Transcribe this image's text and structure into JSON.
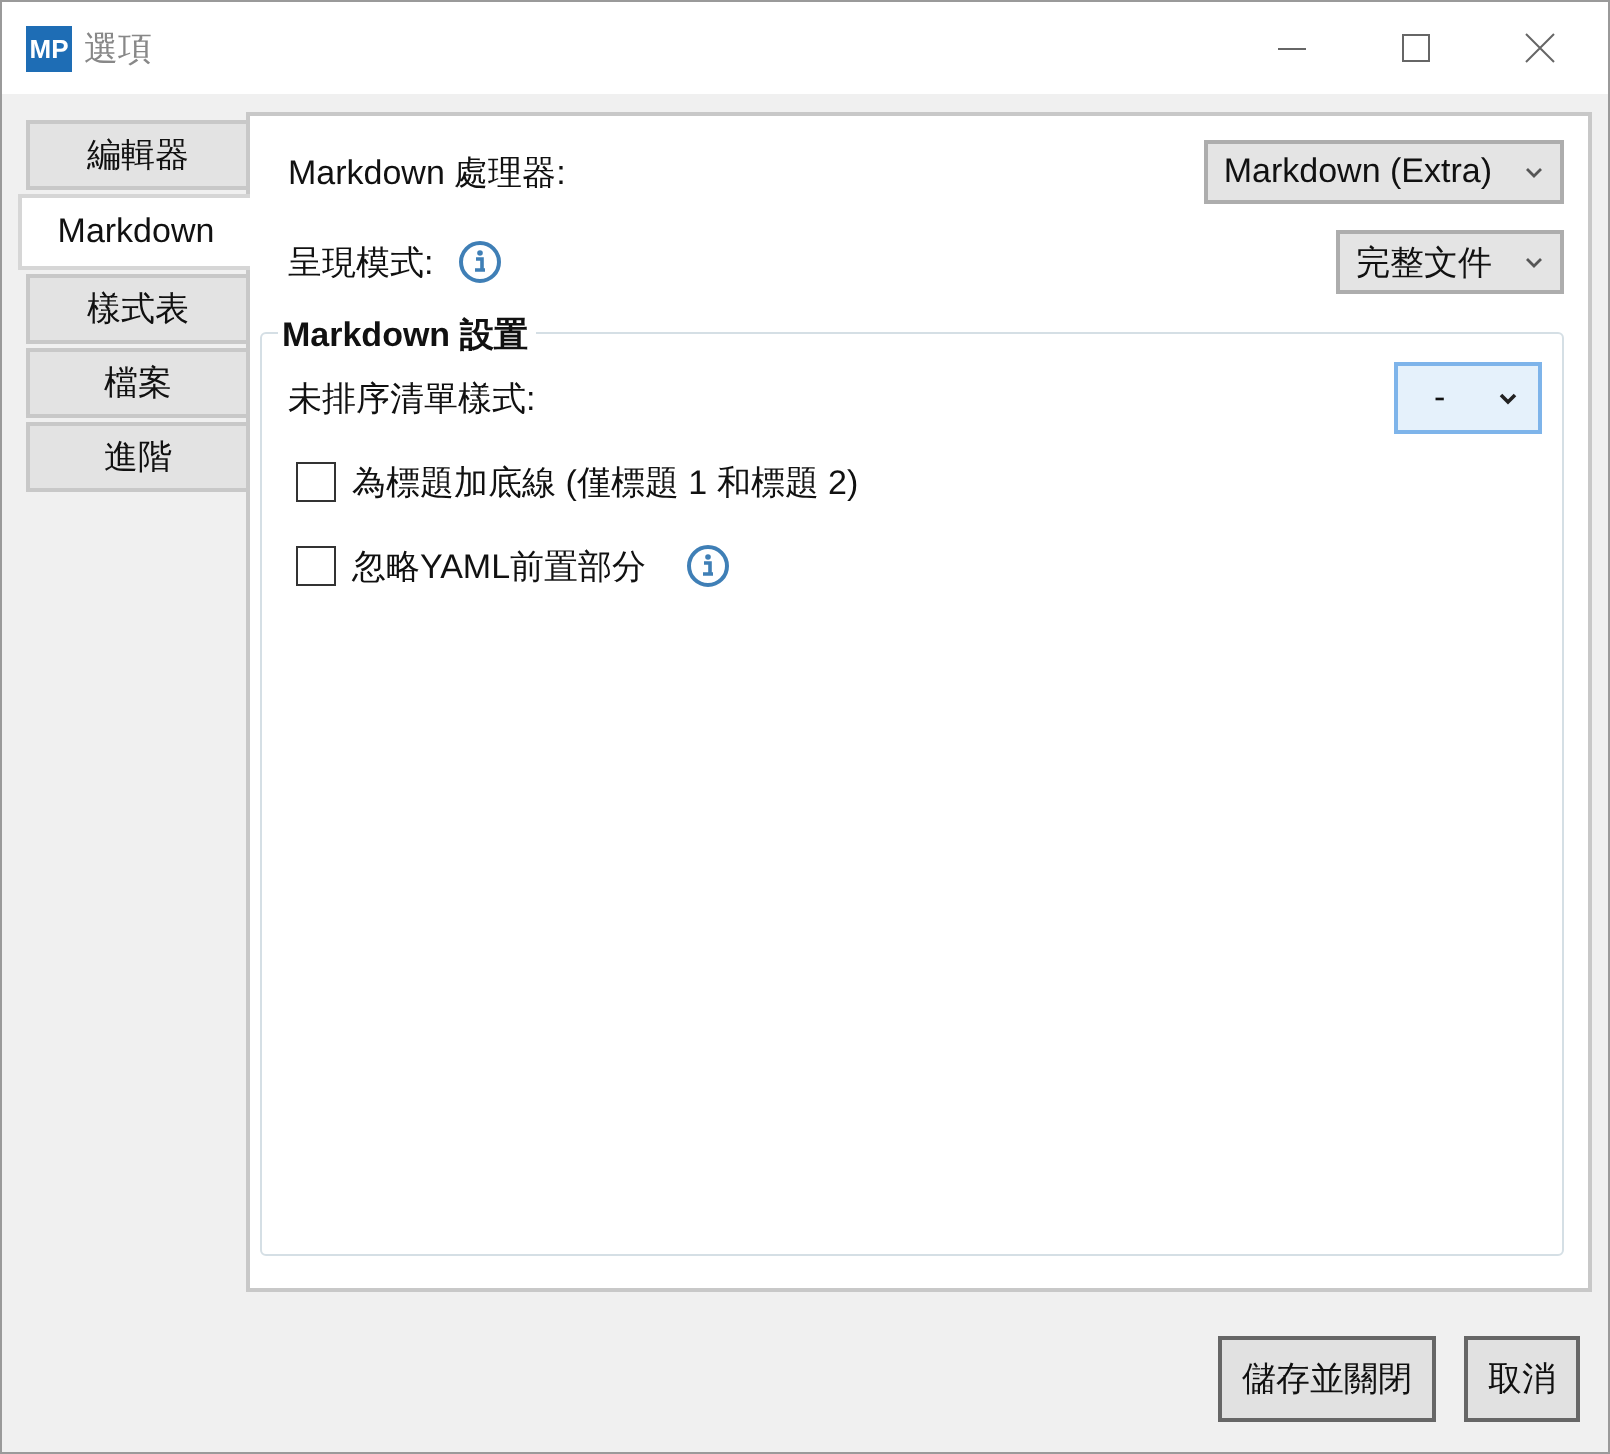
{
  "window": {
    "logo": "MP",
    "title": "選項"
  },
  "tabs": [
    {
      "label": "編輯器",
      "selected": false
    },
    {
      "label": "Markdown",
      "selected": true
    },
    {
      "label": "樣式表",
      "selected": false
    },
    {
      "label": "檔案",
      "selected": false
    },
    {
      "label": "進階",
      "selected": false
    }
  ],
  "settings": [
    {
      "kind": "plain",
      "label": "Markdown 處理器:",
      "value": "Markdown (Extra)"
    },
    {
      "kind": "with_info",
      "label": "呈現模式:",
      "value": "完整文件"
    }
  ],
  "group": {
    "title": "Markdown 設置",
    "items": [
      {
        "kind": "dropdown",
        "label": "未排序清單樣式:",
        "value": "-",
        "focused": true
      },
      {
        "kind": "checkbox",
        "label": "為標題加底線 (僅標題 1 和標題 2)",
        "checked": false
      },
      {
        "kind": "checkbox_with_info",
        "label": "忽略YAML前置部分",
        "checked": false
      }
    ]
  },
  "buttons": [
    "儲存並關閉",
    "取消"
  ]
}
